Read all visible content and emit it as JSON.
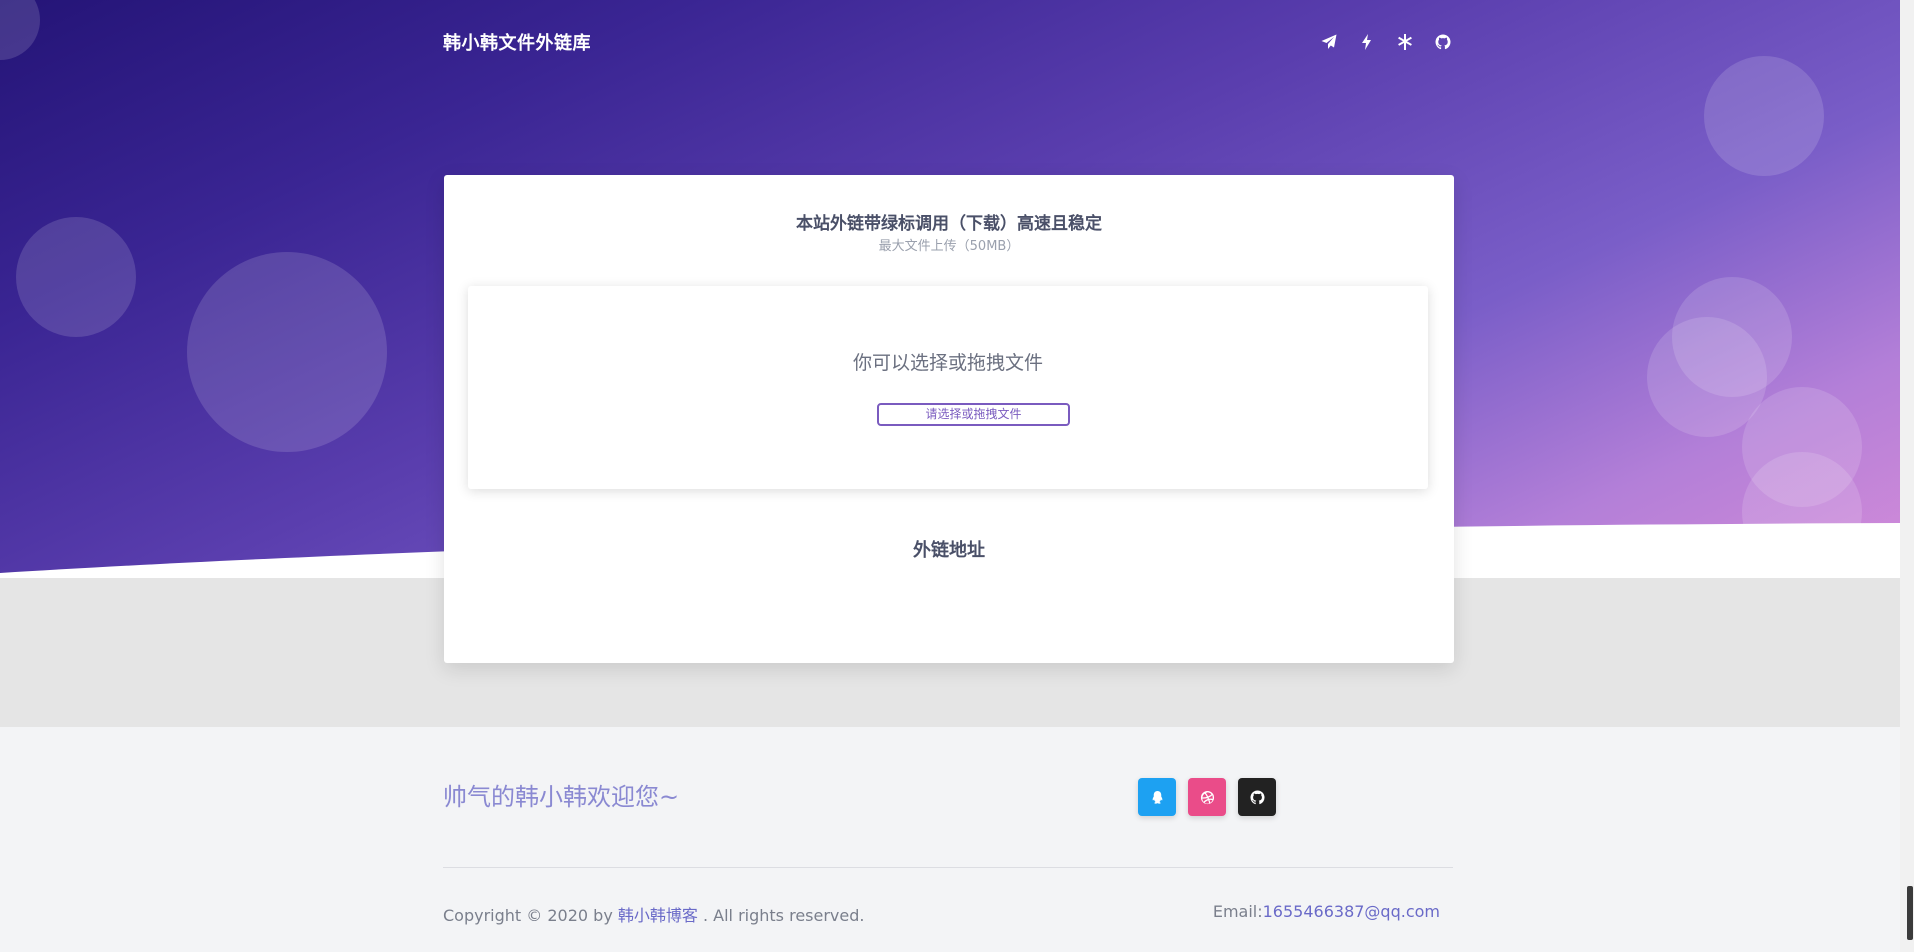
{
  "nav": {
    "brand": "韩小韩文件外链库",
    "icons": [
      "paper-plane-icon",
      "bolt-icon",
      "asterisk-icon",
      "github-icon"
    ]
  },
  "card": {
    "title": "本站外链带绿标调用（下载）高速且稳定",
    "subtitle": "最大文件上传（50MB）",
    "dropzone": {
      "prompt": "你可以选择或拖拽文件",
      "button_label": "请选择或拖拽文件"
    },
    "link_section_title": "外链地址"
  },
  "footer": {
    "slogan": "帅气的韩小韩欢迎您~",
    "social": [
      {
        "name": "qq-icon",
        "color": "#1da1f2"
      },
      {
        "name": "dribbble-icon",
        "color": "#ea4c89"
      },
      {
        "name": "github-icon",
        "color": "#222222"
      }
    ],
    "copyright_prefix": "Copyright © 2020 by",
    "copyright_link": "韩小韩博客",
    "copyright_suffix": ". All rights reserved.",
    "email_label": "Email:",
    "email_address": "1655466387@qq.com"
  },
  "colors": {
    "accent": "#7a5bbf",
    "hero_start": "#241477",
    "hero_end": "#d38bd9"
  }
}
